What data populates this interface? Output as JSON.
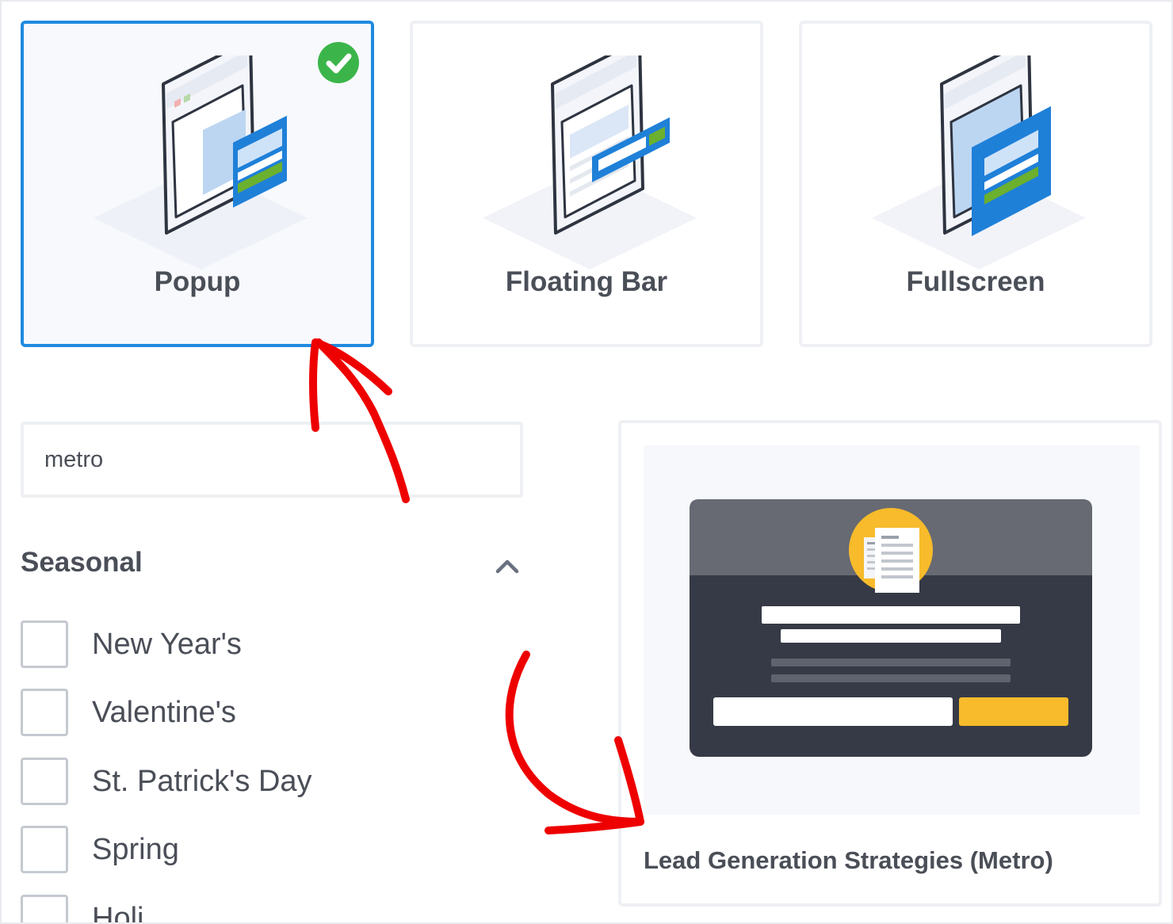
{
  "campaign_types": [
    {
      "label": "Popup",
      "selected": true,
      "icon": "popup-type-icon"
    },
    {
      "label": "Floating Bar",
      "selected": false,
      "icon": "floating-bar-type-icon"
    },
    {
      "label": "Fullscreen",
      "selected": false,
      "icon": "fullscreen-type-icon"
    }
  ],
  "search": {
    "value": "metro",
    "placeholder": ""
  },
  "filters": {
    "title": "Seasonal",
    "collapse_icon": "chevron-up-icon",
    "items": [
      {
        "label": "New Year's",
        "checked": false
      },
      {
        "label": "Valentine's",
        "checked": false
      },
      {
        "label": "St. Patrick's Day",
        "checked": false
      },
      {
        "label": "Spring",
        "checked": false
      },
      {
        "label": "Holi",
        "checked": false
      }
    ]
  },
  "template": {
    "title": "Lead Generation Strategies (Metro)",
    "thumbnail_icon": "document-icon"
  },
  "colors": {
    "selected_border": "#1f8ae0",
    "check_green": "#3bb54a",
    "annotation_red": "#ee0000",
    "template_dark": "#363a46",
    "template_header": "#676a73",
    "template_button": "#f7bb2b",
    "text": "#4a4e57"
  }
}
